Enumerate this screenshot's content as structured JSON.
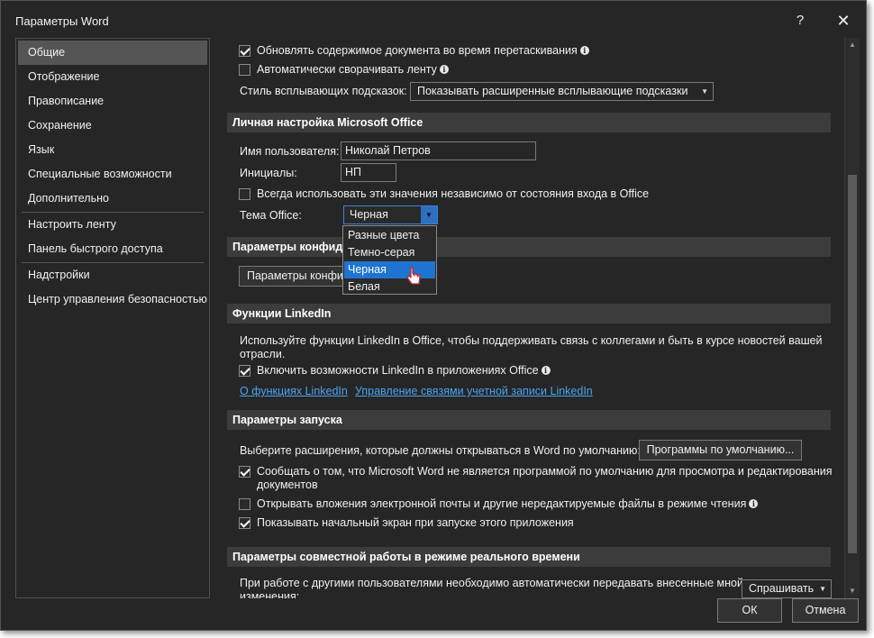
{
  "window": {
    "title": "Параметры Word",
    "help_glyph": "?",
    "close_glyph": "✕"
  },
  "sidebar": {
    "items": [
      {
        "label": "Общие",
        "active": true
      },
      {
        "label": "Отображение"
      },
      {
        "label": "Правописание"
      },
      {
        "label": "Сохранение"
      },
      {
        "label": "Язык"
      },
      {
        "label": "Специальные возможности"
      },
      {
        "label": "Дополнительно"
      },
      {
        "label": "Настроить ленту"
      },
      {
        "label": "Панель быстрого доступа"
      },
      {
        "label": "Надстройки"
      },
      {
        "label": "Центр управления безопасностью"
      }
    ]
  },
  "ui_options": {
    "update_content_while_dragging": {
      "label": "Обновлять содержимое документа во время перетаскивания",
      "checked": true
    },
    "collapse_ribbon": {
      "label": "Автоматически сворачивать ленту",
      "checked": false
    },
    "screentip_style": {
      "label": "Стиль всплывающих подсказок:",
      "value": "Показывать расширенные всплывающие подсказки"
    }
  },
  "personalize": {
    "header": "Личная настройка Microsoft Office",
    "username_label": "Имя пользователя:",
    "username_value": "Николай Петров",
    "initials_label": "Инициалы:",
    "initials_value": "НП",
    "always_use": {
      "label": "Всегда использовать эти значения независимо от состояния входа в Office",
      "checked": false
    },
    "theme_label": "Тема Office:",
    "theme_value": "Черная",
    "theme_options": [
      "Разные цвета",
      "Темно-серая",
      "Черная",
      "Белая"
    ],
    "theme_selected_index": 2
  },
  "privacy": {
    "header": "Параметры конфиденциальности",
    "button": "Параметры конфиденциальности..."
  },
  "linkedin": {
    "header": "Функции LinkedIn",
    "description_line1": "Используйте функции LinkedIn в Office, чтобы поддерживать связь с коллегами и быть в курсе новостей вашей",
    "description_line2": "отрасли.",
    "enable": {
      "label": "Включить возможности LinkedIn в приложениях Office",
      "checked": true
    },
    "link_about": "О функциях LinkedIn",
    "link_manage": "Управление связями учетной записи LinkedIn"
  },
  "startup": {
    "header": "Параметры запуска",
    "extensions_label": "Выберите расширения, которые должны открываться в Word по умолчанию:",
    "default_programs_button": "Программы по умолчанию...",
    "notify_default": {
      "label_line1": "Сообщать о том, что Microsoft Word не является программой по умолчанию для просмотра и редактирования",
      "label_line2": "документов",
      "checked": true
    },
    "open_attachments": {
      "label": "Открывать вложения электронной почты и другие нередактируемые файлы в режиме чтения",
      "checked": false
    },
    "show_start_screen": {
      "label": "Показывать начальный экран при запуске этого приложения",
      "checked": true
    }
  },
  "coauthoring": {
    "header": "Параметры совместной работы в режиме реального времени",
    "description_line1": "При работе с другими пользователями необходимо автоматически передавать внесенные мной",
    "description_line2": "изменения:",
    "select_value": "Спрашивать"
  },
  "footer": {
    "ok": "ОК",
    "cancel": "Отмена"
  },
  "colors": {
    "background": "#262626",
    "section_header": "#3c3c3c",
    "selection": "#1e74d0",
    "link": "#4aa3f0"
  }
}
